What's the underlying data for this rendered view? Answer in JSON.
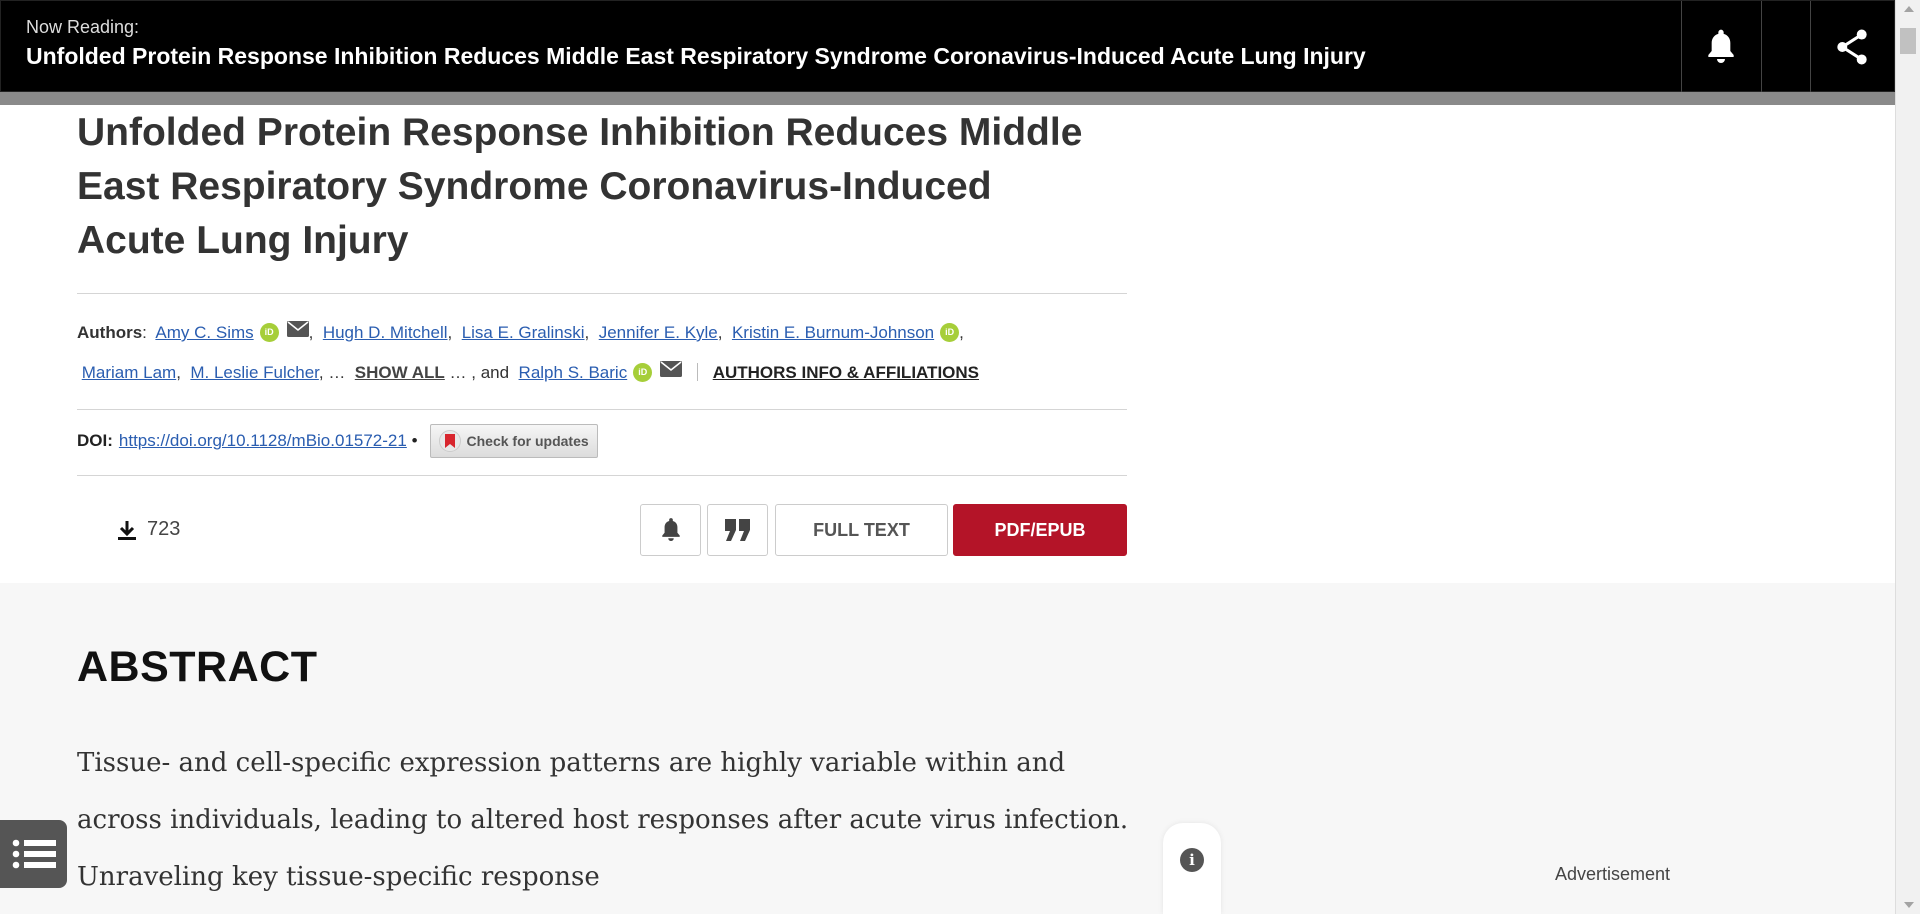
{
  "topbar": {
    "now_reading_label": "Now Reading:",
    "title": "Unfolded Protein Response Inhibition Reduces Middle East Respiratory Syndrome Coronavirus-Induced Acute Lung Injury",
    "icons": [
      "bell-icon",
      "share-icon"
    ]
  },
  "article": {
    "title": "Unfolded Protein Response Inhibition Reduces Middle East Respiratory Syndrome Coronavirus-Induced Acute Lung Injury",
    "authors_label": "Authors",
    "authors": [
      {
        "name": "Amy C. Sims",
        "orcid": true,
        "email": true
      },
      {
        "name": "Hugh D. Mitchell"
      },
      {
        "name": "Lisa E. Gralinski"
      },
      {
        "name": "Jennifer E. Kyle"
      },
      {
        "name": "Kristin E. Burnum-Johnson",
        "orcid": true
      },
      {
        "name": "Mariam Lam"
      },
      {
        "name": "M. Leslie Fulcher"
      }
    ],
    "show_all_label": "SHOW ALL",
    "ellipsis_before": "…",
    "ellipsis_after": "… , and",
    "last_author": "Ralph S. Baric",
    "authors_info_label": "AUTHORS INFO & AFFILIATIONS",
    "orcid_text": "iD",
    "doi_label": "DOI:",
    "doi_link": "https://doi.org/10.1128/mBio.01572-21",
    "doi_sep": "•",
    "check_updates_label": "Check for updates",
    "download_count": "723",
    "full_text_label": "FULL TEXT",
    "pdf_label": "PDF/EPUB"
  },
  "abstract": {
    "heading": "ABSTRACT",
    "text": "Tissue- and cell-specific expression patterns are highly variable within and across individuals, leading to altered host responses after acute virus infection. Unraveling key tissue-specific response"
  },
  "sidebar": {
    "advertisement_label": "Advertisement"
  },
  "colors": {
    "brand_red": "#b41428",
    "link_blue": "#2a5db0",
    "orcid_green": "#a6ce39"
  }
}
